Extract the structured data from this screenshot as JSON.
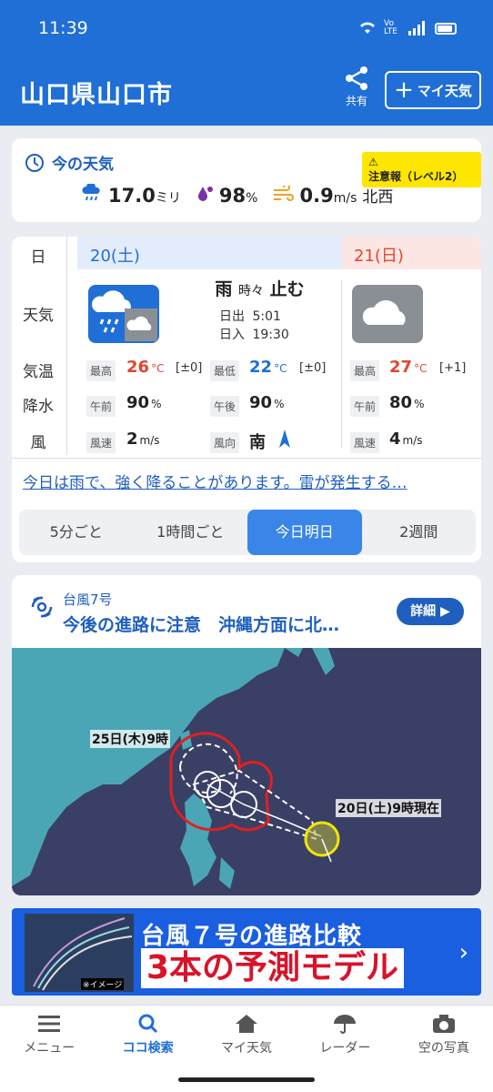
{
  "status": {
    "time": "11:39",
    "net": "Vo LTE"
  },
  "header": {
    "title": "山口県山口市",
    "share": "共有",
    "my_weather": "マイ天気"
  },
  "now": {
    "label": "今の天気",
    "warning": "注意報（レベル2）",
    "rain_value": "17.0",
    "rain_unit": "ミリ",
    "humidity_value": "98",
    "humidity_unit": "%",
    "wind_value": "0.9",
    "wind_unit": "m/s",
    "wind_dir": "北西"
  },
  "forecast": {
    "row_labels": [
      "日",
      "天気",
      "気温",
      "降水",
      "風"
    ],
    "day1": {
      "date": "20(土)",
      "weather": "雨",
      "weather_mid": "時々",
      "weather_end": "止む",
      "sunrise_label": "日出",
      "sunrise": "5:01",
      "sunset_label": "日入",
      "sunset": "19:30",
      "high_label": "最高",
      "high": "26",
      "high_diff": "[±0]",
      "low_label": "最低",
      "low": "22",
      "low_diff": "[±0]",
      "am_label": "午前",
      "am": "90",
      "pm_label": "午後",
      "pm": "90",
      "wind_label": "風速",
      "wind": "2",
      "dir_label": "風向",
      "dir": "南"
    },
    "day2": {
      "date": "21(日)",
      "high_label": "最高",
      "high": "27",
      "high_diff": "[+1]",
      "am_label": "午前",
      "am": "80",
      "wind_label": "風速",
      "wind": "4"
    },
    "temp_unit": "°C",
    "pct_unit": "%",
    "wind_unit": "m/s",
    "comment": "今日は雨で、強く降ることがあります。雷が発生する…",
    "tabs": [
      "5分ごと",
      "1時間ごと",
      "今日明日",
      "2週間"
    ],
    "active_tab": 2
  },
  "typhoon": {
    "name": "台風7号",
    "headline": "今後の進路に注意　沖縄方面に北…",
    "detail": "詳細",
    "label_forecast": "25日(木)9時",
    "label_now": "20日(土)9時現在"
  },
  "banner": {
    "line1": "台風７号の進路比較",
    "line2": "3本の予測モデル",
    "image_note": "※イメージ"
  },
  "nav": [
    "メニュー",
    "ココ検索",
    "マイ天気",
    "レーダー",
    "空の写真"
  ],
  "colors": {
    "primary": "#1f6fd6",
    "warning": "#ffe600",
    "high": "#e0462c",
    "low": "#1f6fd6"
  }
}
